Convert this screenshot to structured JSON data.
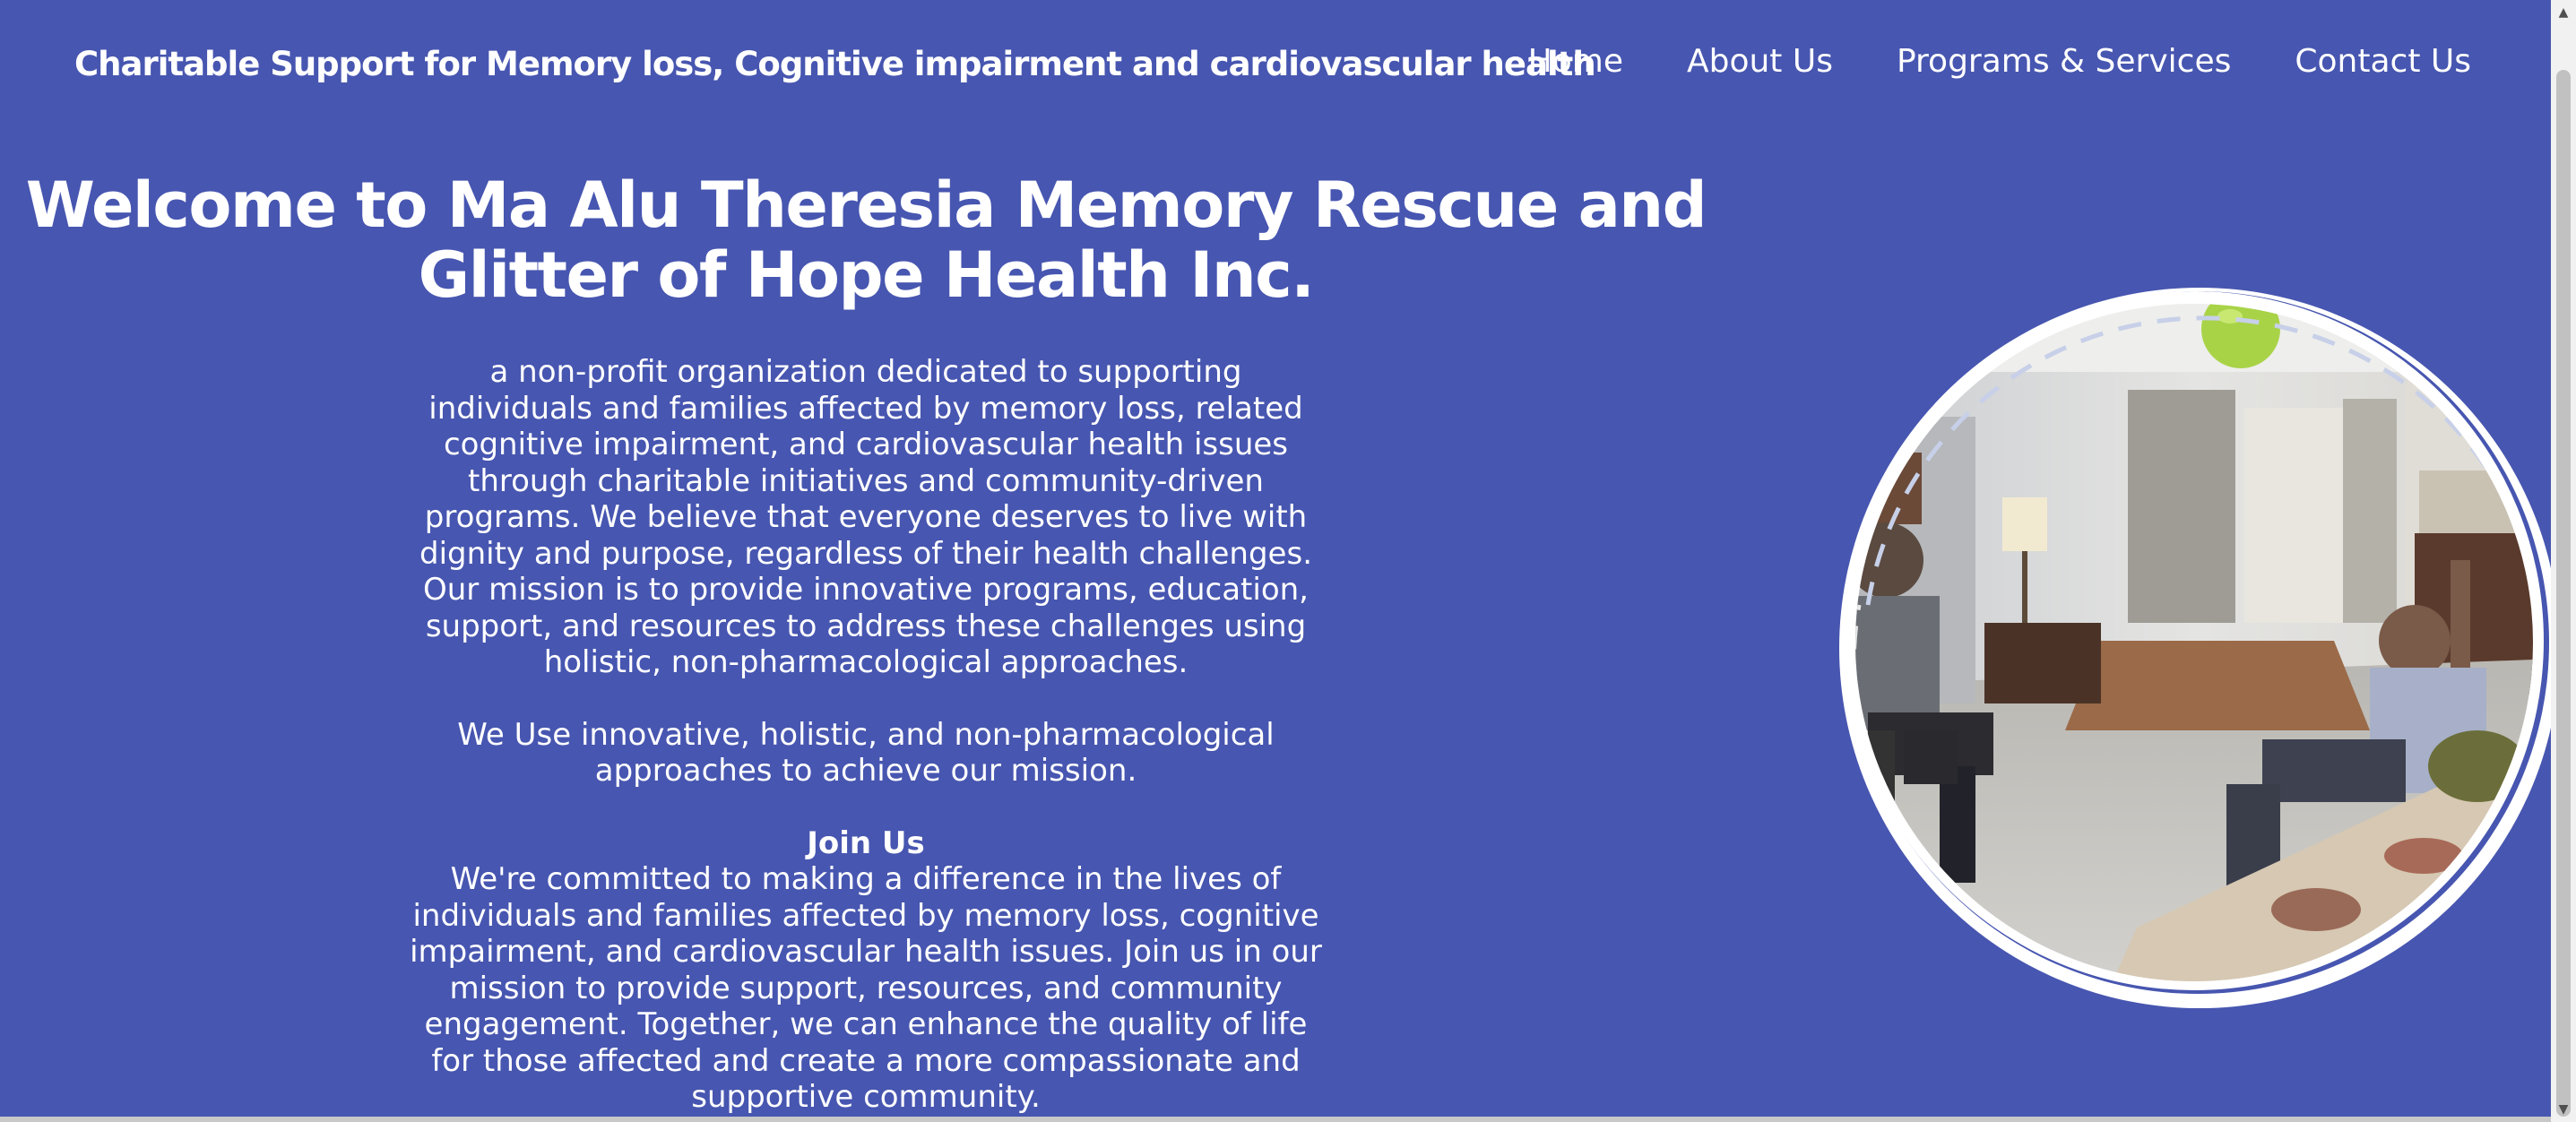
{
  "header": {
    "brand": "Charitable Support for Memory loss, Cognitive impairment and cardiovascular health",
    "nav": [
      {
        "label": "Home"
      },
      {
        "label": "About Us"
      },
      {
        "label": "Programs & Services"
      },
      {
        "label": "Contact Us"
      }
    ]
  },
  "hero": {
    "title": "Welcome to Ma Alu Theresia Memory Rescue and Glitter of Hope Health Inc.",
    "intro": "a non-profit organization dedicated to supporting individuals and families affected by memory loss, related cognitive impairment, and cardiovascular health issues through charitable initiatives and community-driven programs. We believe that everyone deserves to live with dignity and purpose, regardless of their health challenges. Our mission is to provide innovative programs, education, support, and resources to address these challenges using holistic, non-pharmacological approaches.",
    "approach": "We Use innovative, holistic, and non-pharmacological approaches to achieve our mission.",
    "join_heading": "Join Us",
    "join_text": "We're committed to making a difference in the lives of individuals and families affected by memory loss, cognitive impairment, and cardiovascular health issues. Join us in our mission to provide support, resources, and community engagement. Together, we can enhance the quality of life for those affected and create a more compassionate and supportive community."
  },
  "colors": {
    "background": "#4756b0",
    "text": "#ffffff",
    "ring": "#ffffff"
  }
}
